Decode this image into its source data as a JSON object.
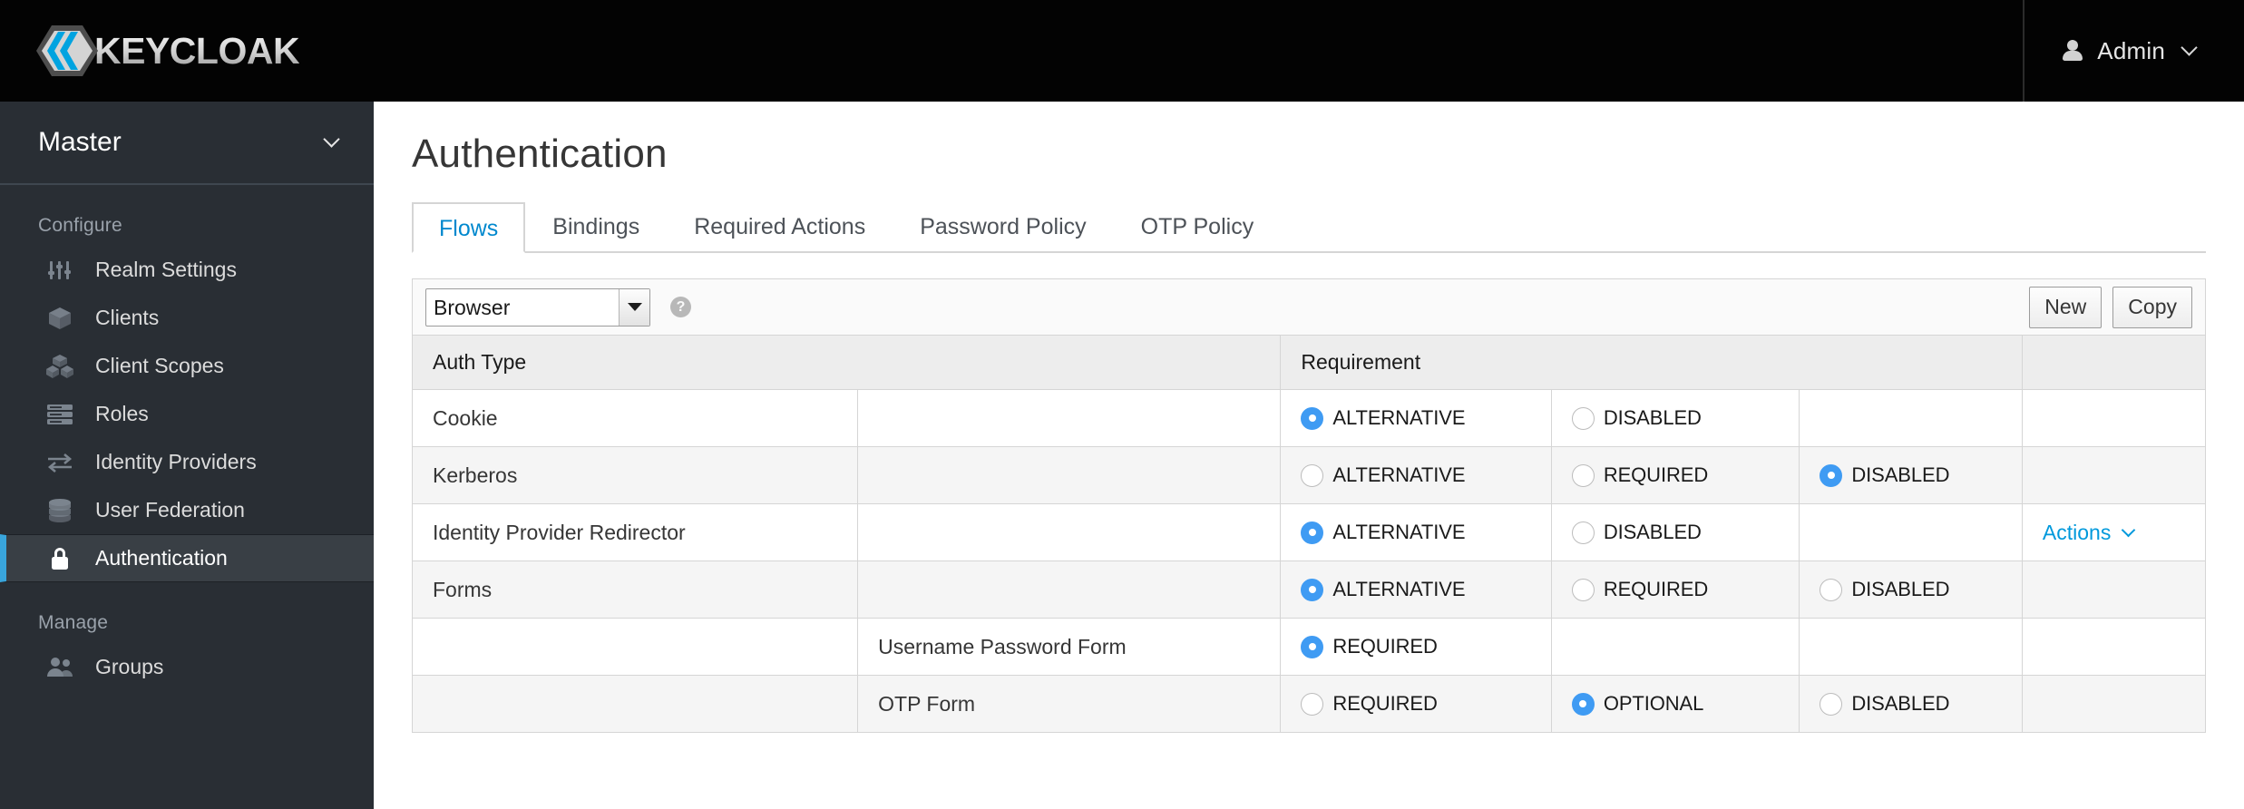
{
  "masthead": {
    "brand_name": "KEYCLOAK",
    "logo_icon": "keycloak-hexagon-logo",
    "user_icon": "user-icon",
    "user_name": "Admin",
    "user_chevron_icon": "chevron-down-icon"
  },
  "sidebar": {
    "realm": {
      "name": "Master",
      "chevron_icon": "chevron-down-icon"
    },
    "sections": [
      {
        "title": "Configure",
        "items": [
          {
            "label": "Realm Settings",
            "icon": "sliders-icon",
            "active": false
          },
          {
            "label": "Clients",
            "icon": "cube-icon",
            "active": false
          },
          {
            "label": "Client Scopes",
            "icon": "cubes-icon",
            "active": false
          },
          {
            "label": "Roles",
            "icon": "list-icon",
            "active": false
          },
          {
            "label": "Identity Providers",
            "icon": "exchange-arrows-icon",
            "active": false
          },
          {
            "label": "User Federation",
            "icon": "database-icon",
            "active": false
          },
          {
            "label": "Authentication",
            "icon": "lock-icon",
            "active": true
          }
        ]
      },
      {
        "title": "Manage",
        "items": [
          {
            "label": "Groups",
            "icon": "users-icon",
            "active": false
          }
        ]
      }
    ]
  },
  "page": {
    "title": "Authentication",
    "tabs": [
      {
        "label": "Flows",
        "active": true
      },
      {
        "label": "Bindings",
        "active": false
      },
      {
        "label": "Required Actions",
        "active": false
      },
      {
        "label": "Password Policy",
        "active": false
      },
      {
        "label": "OTP Policy",
        "active": false
      }
    ]
  },
  "toolbar": {
    "flow_select_value": "Browser",
    "flow_select_options": [
      "Browser"
    ],
    "help_icon": "question-circle-icon",
    "help_glyph": "?",
    "new_button": "New",
    "copy_button": "Copy"
  },
  "table": {
    "headers": {
      "auth_type": "Auth Type",
      "requirement": "Requirement",
      "actions": ""
    },
    "rows": [
      {
        "auth_type": "Cookie",
        "sub_type": "",
        "options": [
          {
            "label": "ALTERNATIVE",
            "selected": true
          },
          {
            "label": "DISABLED",
            "selected": false
          }
        ],
        "actions_label": ""
      },
      {
        "auth_type": "Kerberos",
        "sub_type": "",
        "options": [
          {
            "label": "ALTERNATIVE",
            "selected": false
          },
          {
            "label": "REQUIRED",
            "selected": false
          },
          {
            "label": "DISABLED",
            "selected": true
          }
        ],
        "actions_label": ""
      },
      {
        "auth_type": "Identity Provider Redirector",
        "sub_type": "",
        "options": [
          {
            "label": "ALTERNATIVE",
            "selected": true
          },
          {
            "label": "DISABLED",
            "selected": false
          }
        ],
        "actions_label": "Actions"
      },
      {
        "auth_type": "Forms",
        "sub_type": "",
        "options": [
          {
            "label": "ALTERNATIVE",
            "selected": true
          },
          {
            "label": "REQUIRED",
            "selected": false
          },
          {
            "label": "DISABLED",
            "selected": false
          }
        ],
        "actions_label": ""
      },
      {
        "auth_type": "",
        "sub_type": "Username Password Form",
        "options": [
          {
            "label": "REQUIRED",
            "selected": true
          }
        ],
        "actions_label": ""
      },
      {
        "auth_type": "",
        "sub_type": "OTP Form",
        "options": [
          {
            "label": "REQUIRED",
            "selected": false
          },
          {
            "label": "OPTIONAL",
            "selected": true
          },
          {
            "label": "DISABLED",
            "selected": false
          }
        ],
        "actions_label": ""
      }
    ]
  },
  "colors": {
    "masthead_bg": "#030303",
    "sidebar_bg": "#292e34",
    "sidebar_active_bg": "#393f45",
    "accent_blue": "#39a5dc",
    "link_blue": "#0099dc",
    "radio_blue": "#3f9bf3",
    "tab_active": "#0088ce"
  }
}
